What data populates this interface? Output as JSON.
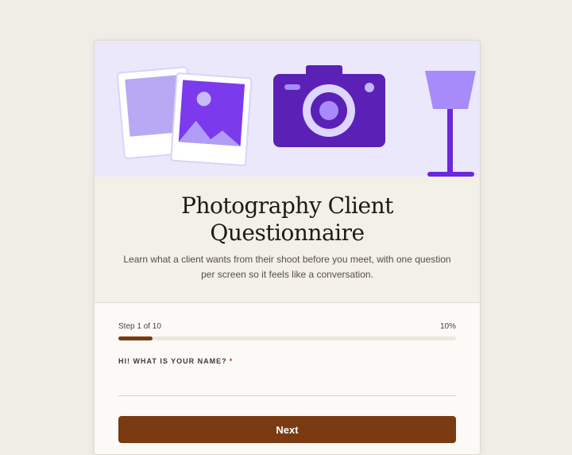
{
  "form": {
    "title_line1": "Photography Client",
    "title_line2": "Questionnaire",
    "description": "Learn what a client wants from their shoot before you meet, with one question per screen so it feels like a conversation."
  },
  "progress": {
    "step_label": "Step 1 of 10",
    "percent_label": "10%",
    "percent": 10
  },
  "question": {
    "label": "HI! WHAT IS YOUR NAME?",
    "required_mark": "*",
    "answer_value": ""
  },
  "actions": {
    "next_label": "Next"
  },
  "colors": {
    "accent": "#7a3a12",
    "hero_bg": "#ebe8fb",
    "illustration_purple": "#5b21b6"
  },
  "illustrations": [
    "photo-prints-icon",
    "camera-icon",
    "lamp-icon"
  ]
}
